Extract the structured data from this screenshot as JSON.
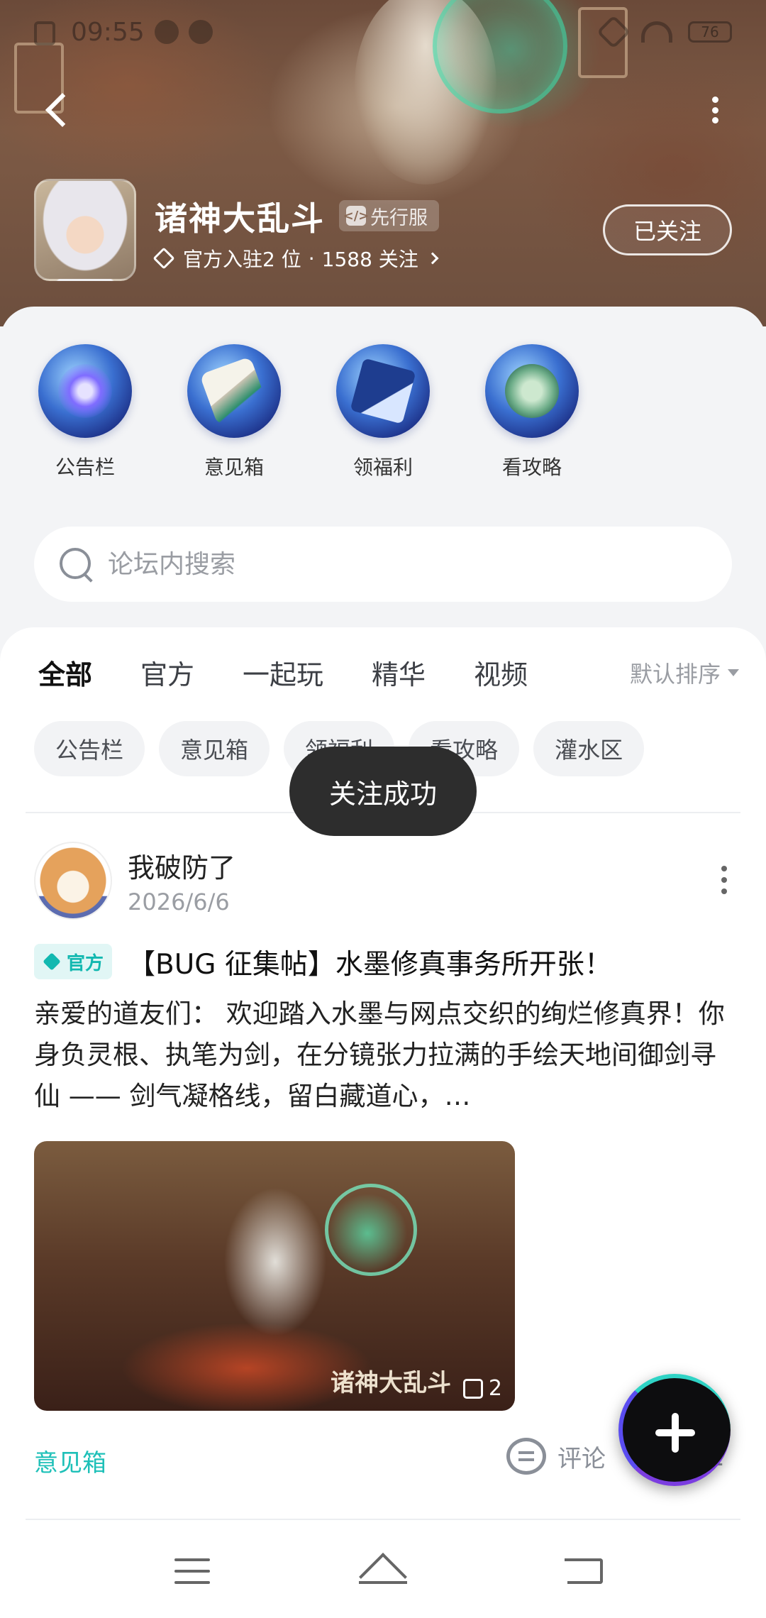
{
  "status_bar": {
    "time": "09:55",
    "battery": "76"
  },
  "header": {
    "game_title": "诸神大乱斗",
    "server_badge": "先行服",
    "server_icon_text": "</>",
    "meta_official": "官方入驻2 位",
    "meta_separator": "·",
    "meta_followers": "1588 关注",
    "follow_button": "已关注"
  },
  "quick_links": [
    {
      "label": "公告栏",
      "icon": "galaxy-orb-icon"
    },
    {
      "label": "意见箱",
      "icon": "scroll-orb-icon"
    },
    {
      "label": "领福利",
      "icon": "flag-orb-icon"
    },
    {
      "label": "看攻略",
      "icon": "lotus-orb-icon"
    }
  ],
  "search": {
    "placeholder": "论坛内搜索"
  },
  "tabs": [
    {
      "label": "全部",
      "active": true
    },
    {
      "label": "官方",
      "active": false
    },
    {
      "label": "一起玩",
      "active": false
    },
    {
      "label": "精华",
      "active": false
    },
    {
      "label": "视频",
      "active": false
    }
  ],
  "sort": {
    "label": "默认排序"
  },
  "chips": [
    "公告栏",
    "意见箱",
    "领福利",
    "看攻略",
    "灌水区"
  ],
  "toast": "关注成功",
  "post": {
    "author": "我破防了",
    "date": "2026/6/6",
    "official_badge": "官方",
    "title": "【BUG 征集帖】水墨修真事务所开张！",
    "body": "亲爱的道友们： 欢迎踏入水墨与网点交织的绚烂修真界！你身负灵根、执笔为剑，在分镜张力拉满的手绘天地间御剑寻仙 —— 剑气凝格线，留白藏道心，…",
    "image_watermark": "诸神大乱斗",
    "image_count": "2",
    "tag": "意见箱",
    "comment_label": "评论",
    "like_count": "2"
  },
  "colors": {
    "accent": "#1ec8c0",
    "toast_bg": "#2d2d2d"
  }
}
